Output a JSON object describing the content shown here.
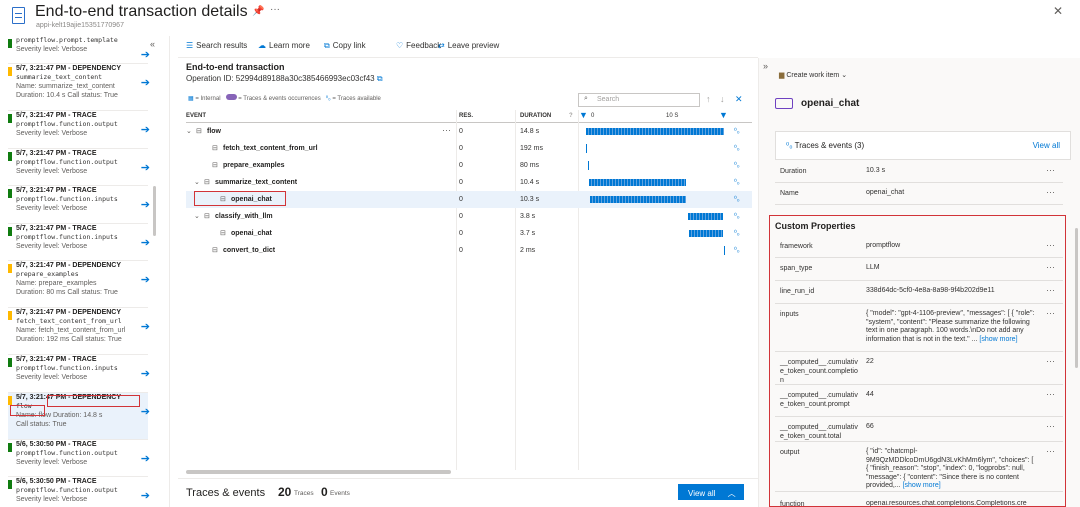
{
  "header": {
    "title": "End-to-end transaction details",
    "subtitle": "appi-kelt19ajie15351770967"
  },
  "sidebar": {
    "items": [
      {
        "head": "",
        "code": "promptflow.prompt.template",
        "meta1": "Severity level: Verbose",
        "meta2": "",
        "color": "#107c10"
      },
      {
        "head": "5/7, 3:21:47 PM - DEPENDENCY",
        "code": "summarize_text_content",
        "meta1": "Name: summarize_text_content",
        "meta2": "Duration: 10.4 s   Call status: True",
        "color": "#ffb900"
      },
      {
        "head": "5/7, 3:21:47 PM - TRACE",
        "code": "promptflow.function.output",
        "meta1": "Severity level: Verbose",
        "meta2": "",
        "color": "#107c10"
      },
      {
        "head": "5/7, 3:21:47 PM - TRACE",
        "code": "promptflow.function.output",
        "meta1": "Severity level: Verbose",
        "meta2": "",
        "color": "#107c10"
      },
      {
        "head": "5/7, 3:21:47 PM - TRACE",
        "code": "promptflow.function.inputs",
        "meta1": "Severity level: Verbose",
        "meta2": "",
        "color": "#107c10"
      },
      {
        "head": "5/7, 3:21:47 PM - TRACE",
        "code": "promptflow.function.inputs",
        "meta1": "Severity level: Verbose",
        "meta2": "",
        "color": "#107c10"
      },
      {
        "head": "5/7, 3:21:47 PM - DEPENDENCY",
        "code": "prepare_examples",
        "meta1": "Name: prepare_examples",
        "meta2": "Duration: 80 ms   Call status: True",
        "color": "#ffb900"
      },
      {
        "head": "5/7, 3:21:47 PM - DEPENDENCY",
        "code": "fetch_text_content_from_url",
        "meta1": "Name: fetch_text_content_from_url",
        "meta2": "Duration: 192 ms   Call status: True",
        "color": "#ffb900"
      },
      {
        "head": "5/7, 3:21:47 PM - TRACE",
        "code": "promptflow.function.inputs",
        "meta1": "Severity level: Verbose",
        "meta2": "",
        "color": "#107c10"
      },
      {
        "head": "5/7, 3:21:47 PM - DEPENDENCY",
        "code": "flow",
        "meta1": "Name: flow   Duration: 14.8 s",
        "meta2": "Call status: True",
        "color": "#ffb900"
      },
      {
        "head": "5/6, 5:30:50 PM - TRACE",
        "code": "promptflow.function.output",
        "meta1": "Severity level: Verbose",
        "meta2": "",
        "color": "#107c10"
      },
      {
        "head": "5/6, 5:30:50 PM - TRACE",
        "code": "promptflow.function.output",
        "meta1": "Severity level: Verbose",
        "meta2": "",
        "color": "#107c10"
      }
    ]
  },
  "toolbar": {
    "search_results": "Search results",
    "learn_more": "Learn more",
    "copy_link": "Copy link",
    "feedback": "Feedback",
    "leave_preview": "Leave preview"
  },
  "transaction": {
    "title": "End-to-end transaction",
    "operation_id": "Operation ID: 52994d89188a30c385466993ec03cf43",
    "legend_internal": "= Internal",
    "legend_traces": "= Traces & events occurrences",
    "legend_available": "= Traces available",
    "search_placeholder": "Search",
    "col_event": "EVENT",
    "col_res": "RES.",
    "col_duration": "DURATION",
    "timeline_0": "0",
    "timeline_10": "10 S",
    "rows": [
      {
        "name": "flow",
        "res": "0",
        "dur": "14.8 s"
      },
      {
        "name": "fetch_text_content_from_url",
        "res": "0",
        "dur": "192 ms"
      },
      {
        "name": "prepare_examples",
        "res": "0",
        "dur": "80 ms"
      },
      {
        "name": "summarize_text_content",
        "res": "0",
        "dur": "10.4 s"
      },
      {
        "name": "openai_chat",
        "res": "0",
        "dur": "10.3 s"
      },
      {
        "name": "classify_with_llm",
        "res": "0",
        "dur": "3.8 s"
      },
      {
        "name": "openai_chat",
        "res": "0",
        "dur": "3.7 s"
      },
      {
        "name": "convert_to_dict",
        "res": "0",
        "dur": "2 ms"
      }
    ]
  },
  "footer": {
    "title": "Traces & events",
    "traces_count": "20",
    "traces_label": "Traces",
    "events_count": "0",
    "events_label": "Events",
    "view_all": "View all"
  },
  "right_panel": {
    "create_work_item": "Create work item",
    "name": "openai_chat",
    "traces_events": "Traces & events (3)",
    "view_all": "View all",
    "duration_key": "Duration",
    "duration_val": "10.3 s",
    "name_key": "Name",
    "name_val": "openai_chat",
    "custom_props_title": "Custom Properties",
    "props": [
      {
        "k": "framework",
        "v": "promptflow"
      },
      {
        "k": "span_type",
        "v": "LLM"
      },
      {
        "k": "line_run_id",
        "v": "338d64dc-5cf0-4e8a-8a98-9f4b202d9e11"
      },
      {
        "k": "inputs",
        "v": "{ \"model\": \"gpt-4-1106-preview\", \"messages\": [ { \"role\": \"system\", \"content\": \"Please summarize the following text in one paragraph. 100 words.\\nDo not add any information that is not in the text.\" ..."
      },
      {
        "k": "__computed__.cumulative_token_count.completion",
        "v": "22"
      },
      {
        "k": "__computed__.cumulative_token_count.prompt",
        "v": "44"
      },
      {
        "k": "__computed__.cumulative_token_count.total",
        "v": "66"
      },
      {
        "k": "output",
        "v": "{ \"id\": \"chatcmpl-9M9QzMDDlcoDmU6gdN3LvKhMm6lym\", \"choices\": [ { \"finish_reason\": \"stop\", \"index\": 0, \"logprobs\": null, \"message\": { \"content\": \"Since there is no content provided,..."
      },
      {
        "k": "function",
        "v": "openai.resources.chat.completions.Completions.cre"
      }
    ],
    "show_more": "[show more]"
  }
}
